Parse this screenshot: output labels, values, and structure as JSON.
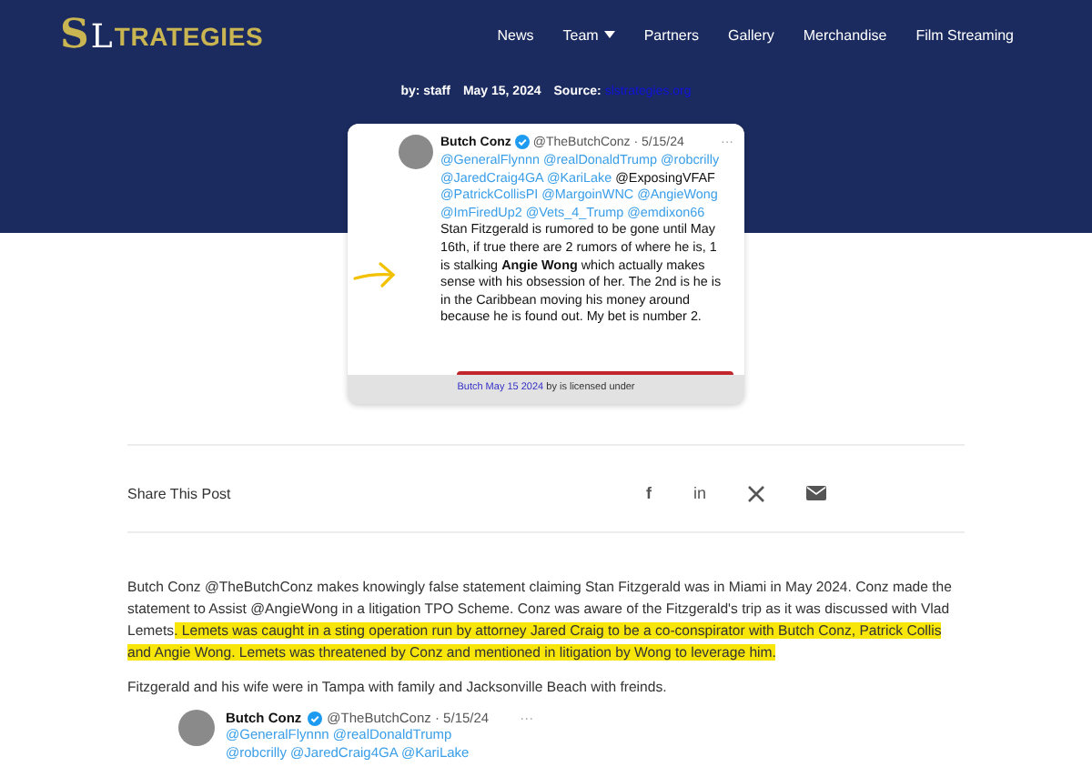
{
  "header": {
    "logo": {
      "monogram_1": "S",
      "monogram_2": "L",
      "text": "TRATEGIES"
    },
    "nav": [
      {
        "label": "News",
        "dropdown": false
      },
      {
        "label": "Team",
        "dropdown": true
      },
      {
        "label": "Partners",
        "dropdown": false
      },
      {
        "label": "Gallery",
        "dropdown": false
      },
      {
        "label": "Merchandise",
        "dropdown": false
      },
      {
        "label": "Film Streaming",
        "dropdown": false
      }
    ]
  },
  "byline": {
    "author": "by: staff",
    "date": "May 15, 2024",
    "source_label": "Source:",
    "source_link": "slstrategies.org"
  },
  "figure": {
    "tweet": {
      "name": "Butch Conz",
      "verified": true,
      "handle": "@TheButchConz · 5/15/24",
      "more": "···",
      "body": [
        {
          "kind": "mention",
          "text": "@GeneralFlynnn"
        },
        {
          "kind": "mention",
          "text": "@realDonaldTrump"
        },
        {
          "kind": "mention",
          "text": "@robcrilly"
        },
        {
          "kind": "mention",
          "text": "@JaredCraig4GA"
        },
        {
          "kind": "mention",
          "text": "@KariLake"
        },
        {
          "kind": "text",
          "text": "@ExposingVFAF"
        },
        {
          "kind": "mention",
          "text": "@PatrickCollisPI"
        },
        {
          "kind": "mention",
          "text": "@MargoinWNC"
        },
        {
          "kind": "mention",
          "text": "@AngieWong"
        },
        {
          "kind": "mention",
          "text": "@ImFiredUp2"
        },
        {
          "kind": "mention",
          "text": "@Vets_4_Trump"
        },
        {
          "kind": "mention",
          "text": "@emdixon66"
        },
        {
          "kind": "text",
          "text": "Stan Fitzgerald is rumored to be gone until May 16th, if true there are 2 rumors of where he is, 1 is stalking **Angie Wong** which actually makes sense with his obsession of her. The 2nd is he is in the Caribbean moving his money around because he is found out. My bet is number 2."
        }
      ]
    },
    "caption_link": "Butch May 15 2024",
    "caption_text": "by is licensed under"
  },
  "share": {
    "label": "Share This Post",
    "icons": [
      {
        "kind": "facebook",
        "text": "f"
      },
      {
        "kind": "linkedin",
        "text": "in"
      },
      {
        "kind": "x"
      },
      {
        "kind": "email"
      }
    ]
  },
  "article": [
    {
      "parts": [
        {
          "text": "Butch Conz @TheButchConz makes knowingly false statement claiming Stan Fitzgerald was in Miami in May 2024. Conz made the statement to Assist @AngieWong in a litigation TPO Scheme. Conz was aware of the Fitzgerald's trip as it was discussed with Vlad Lemets",
          "highlighted": false
        },
        {
          "text": ". Lemets was caught in a sting operation run by attorney Jared Craig to be a co-conspirator with Butch Conz, Patrick Collis and Angie Wong. Lemets was threatened by Conz and mentioned in litigation by Wong to leverage him.",
          "highlighted": true
        }
      ]
    },
    {
      "parts": [
        {
          "text": "Fitzgerald and his wife were in Tampa with family and Jacksonville Beach with freinds.",
          "highlighted": false
        }
      ]
    }
  ],
  "second_tweet": {
    "name": "Butch Conz",
    "verified": true,
    "handle": "@TheButchConz · 5/15/24",
    "more": "···",
    "lines": [
      "@GeneralFlynnn @realDonaldTrump",
      "@robcrilly @JaredCraig4GA @KariLake"
    ]
  }
}
